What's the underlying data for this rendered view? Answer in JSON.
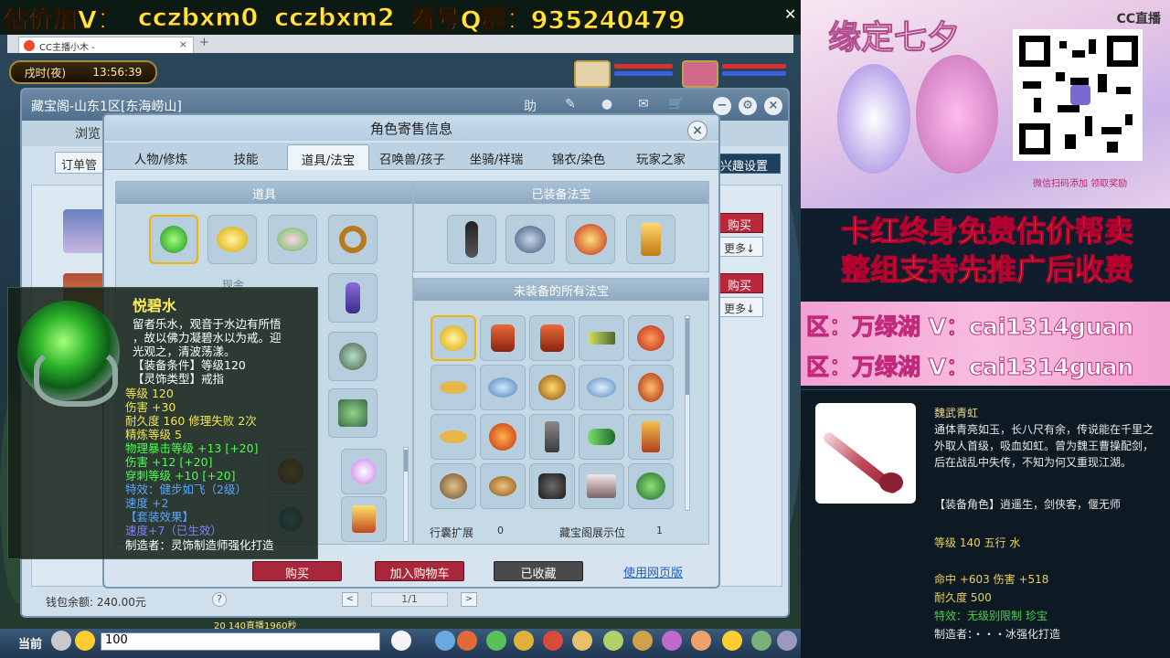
{
  "banner": {
    "part1": "估价加V：",
    "part2": "cczbxm0",
    "part3": "cczbxm2",
    "part4": "看号Q群：935240479"
  },
  "browser": {
    "tab_title": "CC主播小木 -",
    "tab_close": "×",
    "new_tab": "+"
  },
  "game_hud": {
    "clock_label": "戌时(夜)",
    "clock_time": "13:56:39"
  },
  "cbg": {
    "title": "藏宝阁-山东1区[东海崂山]",
    "browse": "浏览",
    "orders": "订单管",
    "fun_settings": "兴趣设置",
    "buy": "购买",
    "more": "更多↓",
    "wallet": "钱包余额: 240.00元",
    "help": "?",
    "prev": "<",
    "next": ">",
    "page": "1/1"
  },
  "dialog": {
    "title": "角色寄售信息",
    "close": "×",
    "tabs": [
      "人物/修炼",
      "技能",
      "道具/法宝",
      "召唤兽/孩子",
      "坐骑/祥瑞",
      "锦衣/染色",
      "玩家之家"
    ],
    "active_tab": 2,
    "items_header": "道具",
    "equipped_header": "已装备法宝",
    "unequipped_header": "未装备的所有法宝",
    "bag_extension_label": "行囊扩展",
    "bag_extension_value": "0",
    "display_label": "藏宝阁展示位",
    "display_value": "1",
    "faded_cash": "现金",
    "buy_button": "购买",
    "cart_button": "加入购物车",
    "fav_button": "已收藏",
    "web_link": "使用网页版"
  },
  "tooltip": {
    "name": "悦碧水",
    "lines": [
      {
        "text": "留者乐水，观音于水边有所悟",
        "color": "w"
      },
      {
        "text": "，故以佛力凝碧水以为戒。迎",
        "color": "w"
      },
      {
        "text": "光观之，清波荡漾。",
        "color": "w"
      },
      {
        "text": "【装备条件】等级120",
        "color": "w"
      },
      {
        "text": "【灵饰类型】戒指",
        "color": "w"
      },
      {
        "text": "等级 120",
        "color": "y"
      },
      {
        "text": "伤害 +30",
        "color": "y"
      },
      {
        "text": "耐久度 160   修理失败 2次",
        "color": "y"
      },
      {
        "text": "精炼等级 5",
        "color": "y"
      },
      {
        "text": "物理暴击等级 +13 [+20]",
        "color": "g"
      },
      {
        "text": "伤害 +12 [+20]",
        "color": "g"
      },
      {
        "text": "穿刺等级 +10 [+20]",
        "color": "g"
      },
      {
        "text": "特效：健步如飞（2级）",
        "color": "b"
      },
      {
        "text": "速度 +2",
        "color": "b"
      },
      {
        "text": "【套装效果】",
        "color": "b"
      },
      {
        "text": "速度+7（已生效）",
        "color": "p"
      },
      {
        "text": "制造者：灵饰制造师强化打造",
        "color": "w"
      }
    ]
  },
  "gamebar": {
    "label": "当前",
    "input_value": "100",
    "strip_text": "20  140直播1960秒"
  },
  "right_panel": {
    "promo_title": "缘定七夕",
    "cc_logo": "CC直播",
    "promo_note": "微信扫码添加 领取奖励",
    "ad_line1": "卡红终身免费估价帮卖",
    "ad_line2": "整组支持先推广后收费",
    "area_line1": "区：万绿湖 V：cai1314guan",
    "area_line2": "区：万绿湖 V：cai1314guan",
    "card": {
      "name": "魏武青虹",
      "desc": "通体青亮如玉，长八尺有余，传说能在千里之外取人首级，吸血如虹。曾为魏王曹操配剑，后在战乱中失传，不知为何又重现江湖。",
      "role": "【装备角色】逍遥生，剑侠客，偃无师",
      "level": "等级 140 五行 水",
      "stats": "命中 +603 伤害 +518",
      "durability": "耐久度 500",
      "effect": "特效：无级别限制 珍宝",
      "maker": "制造者：・・・冰强化打造"
    }
  },
  "colors": {
    "accent_red": "#a8273a",
    "banner_yellow": "#ffe63b",
    "ad_yellow": "#fff62c"
  }
}
